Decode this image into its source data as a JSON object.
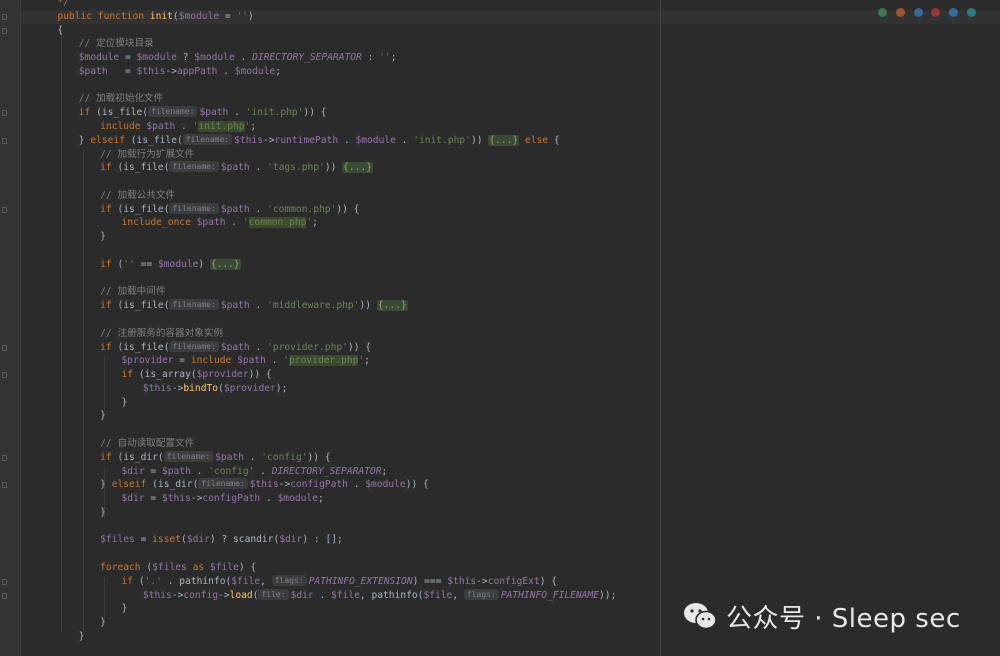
{
  "editor": {
    "lines": [
      {
        "indent": 2,
        "parts": [
          {
            "c": "cmt",
            "t": "*/"
          }
        ]
      },
      {
        "indent": 2,
        "parts": [
          {
            "c": "kw",
            "t": "public function "
          },
          {
            "c": "fn",
            "t": "init"
          },
          {
            "t": "("
          },
          {
            "c": "var",
            "t": "$module"
          },
          {
            "t": " = "
          },
          {
            "c": "str",
            "t": "''"
          },
          {
            "t": ")"
          }
        ]
      },
      {
        "indent": 2,
        "parts": [
          {
            "t": "{"
          }
        ]
      },
      {
        "indent": 4,
        "parts": [
          {
            "c": "cmt",
            "t": "// 定位模块目录"
          }
        ]
      },
      {
        "indent": 4,
        "parts": [
          {
            "c": "var",
            "t": "$module"
          },
          {
            "t": " = "
          },
          {
            "c": "var",
            "t": "$module"
          },
          {
            "t": " ? "
          },
          {
            "c": "var",
            "t": "$module"
          },
          {
            "t": " . "
          },
          {
            "c": "const",
            "t": "DIRECTORY_SEPARATOR"
          },
          {
            "t": " : "
          },
          {
            "c": "str",
            "t": "''"
          },
          {
            "t": ";"
          }
        ]
      },
      {
        "indent": 4,
        "parts": [
          {
            "c": "var",
            "t": "$path"
          },
          {
            "t": "   = "
          },
          {
            "c": "var",
            "t": "$this"
          },
          {
            "t": "->"
          },
          {
            "c": "var",
            "t": "appPath"
          },
          {
            "t": " . "
          },
          {
            "c": "var",
            "t": "$module"
          },
          {
            "t": ";"
          }
        ]
      },
      {
        "indent": 4,
        "parts": []
      },
      {
        "indent": 4,
        "parts": [
          {
            "c": "cmt",
            "t": "// 加载初始化文件"
          }
        ]
      },
      {
        "indent": 4,
        "parts": [
          {
            "c": "kw",
            "t": "if "
          },
          {
            "t": "(is_file("
          },
          {
            "c": "hint",
            "t": "filename:"
          },
          {
            "c": "var",
            "t": "$path"
          },
          {
            "t": " . "
          },
          {
            "c": "str",
            "t": "'init.php'"
          },
          {
            "t": ")) {"
          }
        ]
      },
      {
        "indent": 6,
        "parts": [
          {
            "c": "kw",
            "t": "include "
          },
          {
            "c": "var",
            "t": "$path"
          },
          {
            "t": " . "
          },
          {
            "c": "str",
            "t": "'"
          },
          {
            "c": "hl",
            "t": "init.php"
          },
          {
            "c": "str",
            "t": "'"
          },
          {
            "t": ";"
          }
        ]
      },
      {
        "indent": 4,
        "parts": [
          {
            "t": "} "
          },
          {
            "c": "kw",
            "t": "elseif "
          },
          {
            "t": "(is_file("
          },
          {
            "c": "hint",
            "t": "filename:"
          },
          {
            "c": "var",
            "t": "$this"
          },
          {
            "t": "->"
          },
          {
            "c": "var",
            "t": "runtimePath"
          },
          {
            "t": " . "
          },
          {
            "c": "var",
            "t": "$module"
          },
          {
            "t": " . "
          },
          {
            "c": "str",
            "t": "'init.php'"
          },
          {
            "t": ")) "
          },
          {
            "c": "fold-box",
            "t": "{...}"
          },
          {
            "t": " "
          },
          {
            "c": "kw",
            "t": "else "
          },
          {
            "t": "{"
          }
        ]
      },
      {
        "indent": 6,
        "parts": [
          {
            "c": "cmt",
            "t": "// 加载行为扩展文件"
          }
        ]
      },
      {
        "indent": 6,
        "parts": [
          {
            "c": "kw",
            "t": "if "
          },
          {
            "t": "(is_file("
          },
          {
            "c": "hint",
            "t": "filename:"
          },
          {
            "c": "var",
            "t": "$path"
          },
          {
            "t": " . "
          },
          {
            "c": "str",
            "t": "'tags.php'"
          },
          {
            "t": ")) "
          },
          {
            "c": "fold-box",
            "t": "{...}"
          }
        ]
      },
      {
        "indent": 6,
        "parts": []
      },
      {
        "indent": 6,
        "parts": [
          {
            "c": "cmt",
            "t": "// 加载公共文件"
          }
        ]
      },
      {
        "indent": 6,
        "parts": [
          {
            "c": "kw",
            "t": "if "
          },
          {
            "t": "(is_file("
          },
          {
            "c": "hint",
            "t": "filename:"
          },
          {
            "c": "var",
            "t": "$path"
          },
          {
            "t": " . "
          },
          {
            "c": "str",
            "t": "'common.php'"
          },
          {
            "t": ")) {"
          }
        ]
      },
      {
        "indent": 8,
        "parts": [
          {
            "c": "kw",
            "t": "include_once "
          },
          {
            "c": "var",
            "t": "$path"
          },
          {
            "t": " . "
          },
          {
            "c": "str",
            "t": "'"
          },
          {
            "c": "hl",
            "t": "common.php"
          },
          {
            "c": "str",
            "t": "'"
          },
          {
            "t": ";"
          }
        ]
      },
      {
        "indent": 6,
        "parts": [
          {
            "t": "}"
          }
        ]
      },
      {
        "indent": 6,
        "parts": []
      },
      {
        "indent": 6,
        "parts": [
          {
            "c": "kw",
            "t": "if "
          },
          {
            "t": "("
          },
          {
            "c": "str",
            "t": "''"
          },
          {
            "t": " == "
          },
          {
            "c": "var",
            "t": "$module"
          },
          {
            "t": ") "
          },
          {
            "c": "fold-box",
            "t": "{...}"
          }
        ]
      },
      {
        "indent": 6,
        "parts": []
      },
      {
        "indent": 6,
        "parts": [
          {
            "c": "cmt",
            "t": "// 加载中间件"
          }
        ]
      },
      {
        "indent": 6,
        "parts": [
          {
            "c": "kw",
            "t": "if "
          },
          {
            "t": "(is_file("
          },
          {
            "c": "hint",
            "t": "filename:"
          },
          {
            "c": "var",
            "t": "$path"
          },
          {
            "t": " . "
          },
          {
            "c": "str",
            "t": "'middleware.php'"
          },
          {
            "t": ")) "
          },
          {
            "c": "fold-box",
            "t": "{...}"
          }
        ]
      },
      {
        "indent": 6,
        "parts": []
      },
      {
        "indent": 6,
        "parts": [
          {
            "c": "cmt",
            "t": "// 注册服务的容器对象实例"
          }
        ]
      },
      {
        "indent": 6,
        "parts": [
          {
            "c": "kw",
            "t": "if "
          },
          {
            "t": "(is_file("
          },
          {
            "c": "hint",
            "t": "filename:"
          },
          {
            "c": "var",
            "t": "$path"
          },
          {
            "t": " . "
          },
          {
            "c": "str",
            "t": "'provider.php'"
          },
          {
            "t": ")) {"
          }
        ]
      },
      {
        "indent": 8,
        "parts": [
          {
            "c": "var",
            "t": "$provider"
          },
          {
            "t": " = "
          },
          {
            "c": "kw",
            "t": "include "
          },
          {
            "c": "var",
            "t": "$path"
          },
          {
            "t": " . "
          },
          {
            "c": "str",
            "t": "'"
          },
          {
            "c": "hl",
            "t": "provider.php"
          },
          {
            "c": "str",
            "t": "'"
          },
          {
            "t": ";"
          }
        ]
      },
      {
        "indent": 8,
        "parts": [
          {
            "c": "kw",
            "t": "if "
          },
          {
            "t": "(is_array("
          },
          {
            "c": "var",
            "t": "$provider"
          },
          {
            "t": ")) {"
          }
        ]
      },
      {
        "indent": 10,
        "parts": [
          {
            "c": "var",
            "t": "$this"
          },
          {
            "t": "->"
          },
          {
            "c": "fn",
            "t": "bindTo"
          },
          {
            "t": "("
          },
          {
            "c": "var",
            "t": "$provider"
          },
          {
            "t": ");"
          }
        ]
      },
      {
        "indent": 8,
        "parts": [
          {
            "t": "}"
          }
        ]
      },
      {
        "indent": 6,
        "parts": [
          {
            "t": "}"
          }
        ]
      },
      {
        "indent": 6,
        "parts": []
      },
      {
        "indent": 6,
        "parts": [
          {
            "c": "cmt",
            "t": "// 自动读取配置文件"
          }
        ]
      },
      {
        "indent": 6,
        "parts": [
          {
            "c": "kw",
            "t": "if "
          },
          {
            "t": "(is_dir("
          },
          {
            "c": "hint",
            "t": "filename:"
          },
          {
            "c": "var",
            "t": "$path"
          },
          {
            "t": " . "
          },
          {
            "c": "str",
            "t": "'config'"
          },
          {
            "t": ")) {"
          }
        ]
      },
      {
        "indent": 8,
        "parts": [
          {
            "c": "var",
            "t": "$dir"
          },
          {
            "t": " = "
          },
          {
            "c": "var",
            "t": "$path"
          },
          {
            "t": " . "
          },
          {
            "c": "str",
            "t": "'config'"
          },
          {
            "t": " . "
          },
          {
            "c": "const",
            "t": "DIRECTORY_SEPARATOR"
          },
          {
            "t": ";"
          }
        ]
      },
      {
        "indent": 6,
        "parts": [
          {
            "t": "} "
          },
          {
            "c": "kw",
            "t": "elseif "
          },
          {
            "t": "(is_dir("
          },
          {
            "c": "hint",
            "t": "filename:"
          },
          {
            "c": "var",
            "t": "$this"
          },
          {
            "t": "->"
          },
          {
            "c": "var",
            "t": "configPath"
          },
          {
            "t": " . "
          },
          {
            "c": "var",
            "t": "$module"
          },
          {
            "t": ")) {"
          }
        ]
      },
      {
        "indent": 8,
        "parts": [
          {
            "c": "var",
            "t": "$dir"
          },
          {
            "t": " = "
          },
          {
            "c": "var",
            "t": "$this"
          },
          {
            "t": "->"
          },
          {
            "c": "var",
            "t": "configPath"
          },
          {
            "t": " . "
          },
          {
            "c": "var",
            "t": "$module"
          },
          {
            "t": ";"
          }
        ]
      },
      {
        "indent": 6,
        "parts": [
          {
            "t": "}"
          }
        ]
      },
      {
        "indent": 6,
        "parts": []
      },
      {
        "indent": 6,
        "parts": [
          {
            "c": "var",
            "t": "$files"
          },
          {
            "t": " = "
          },
          {
            "c": "kw",
            "t": "isset"
          },
          {
            "t": "("
          },
          {
            "c": "var",
            "t": "$dir"
          },
          {
            "t": ") ? scandir("
          },
          {
            "c": "var",
            "t": "$dir"
          },
          {
            "t": ") : [];"
          }
        ]
      },
      {
        "indent": 6,
        "parts": []
      },
      {
        "indent": 6,
        "parts": [
          {
            "c": "kw",
            "t": "foreach "
          },
          {
            "t": "("
          },
          {
            "c": "var",
            "t": "$files"
          },
          {
            "c": "kw",
            "t": " as "
          },
          {
            "c": "var",
            "t": "$file"
          },
          {
            "t": ") {"
          }
        ]
      },
      {
        "indent": 8,
        "parts": [
          {
            "c": "kw",
            "t": "if "
          },
          {
            "t": "("
          },
          {
            "c": "str",
            "t": "'.'"
          },
          {
            "t": " . pathinfo("
          },
          {
            "c": "var",
            "t": "$file"
          },
          {
            "t": ", "
          },
          {
            "c": "hint",
            "t": "flags:"
          },
          {
            "c": "const",
            "t": "PATHINFO_EXTENSION"
          },
          {
            "t": ") === "
          },
          {
            "c": "var",
            "t": "$this"
          },
          {
            "t": "->"
          },
          {
            "c": "var",
            "t": "configExt"
          },
          {
            "t": ") {"
          }
        ]
      },
      {
        "indent": 10,
        "parts": [
          {
            "c": "var",
            "t": "$this"
          },
          {
            "t": "->"
          },
          {
            "c": "var",
            "t": "config"
          },
          {
            "t": "->"
          },
          {
            "c": "fn",
            "t": "load"
          },
          {
            "t": "("
          },
          {
            "c": "hint",
            "t": "file:"
          },
          {
            "c": "var",
            "t": "$dir"
          },
          {
            "t": " . "
          },
          {
            "c": "var",
            "t": "$file"
          },
          {
            "t": ", pathinfo("
          },
          {
            "c": "var",
            "t": "$file"
          },
          {
            "t": ", "
          },
          {
            "c": "hint",
            "t": "flags:"
          },
          {
            "c": "const",
            "t": "PATHINFO_FILENAME"
          },
          {
            "t": "));"
          }
        ]
      },
      {
        "indent": 8,
        "parts": [
          {
            "t": "}"
          }
        ]
      },
      {
        "indent": 6,
        "parts": [
          {
            "t": "}"
          }
        ]
      },
      {
        "indent": 4,
        "parts": [
          {
            "t": "}"
          }
        ]
      }
    ]
  },
  "browser_icons": [
    "chrome-icon",
    "firefox-icon",
    "safari-icon",
    "opera-icon",
    "ie-icon",
    "edge-icon"
  ],
  "watermark": {
    "text": "公众号 · Sleep sec"
  }
}
